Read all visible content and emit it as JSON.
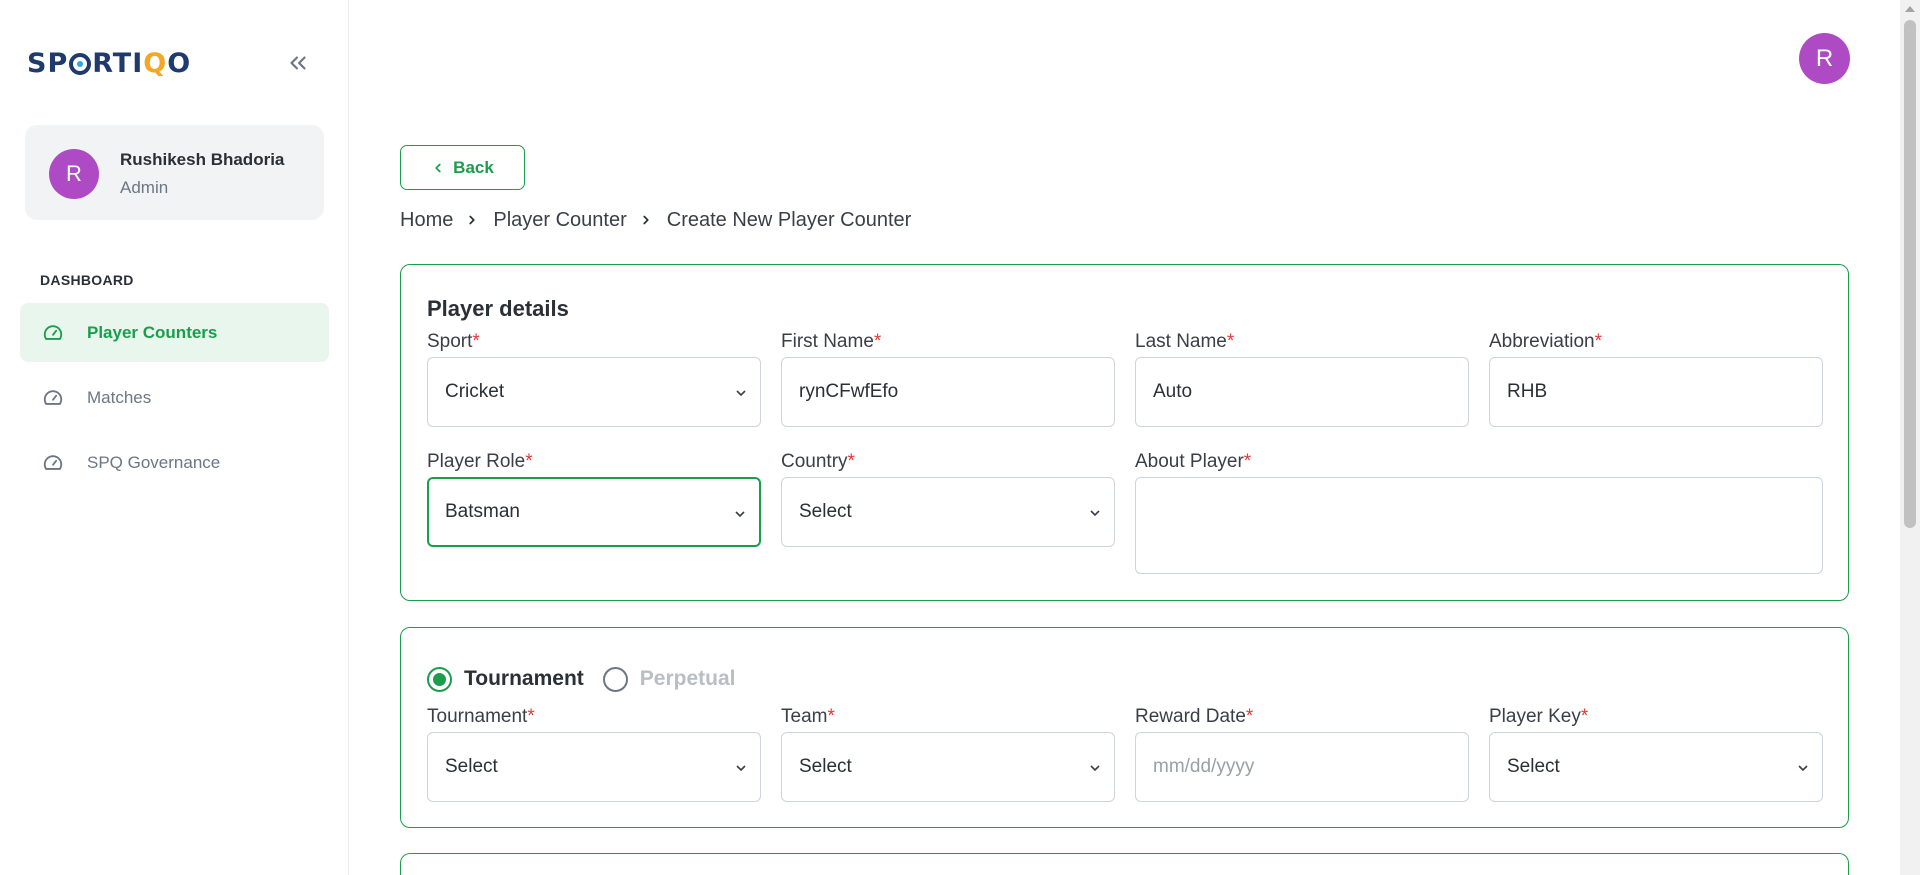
{
  "brand": {
    "logo_pre": "SP",
    "logo_mid": "RTI",
    "logo_accent": "Q",
    "logo_post": "O"
  },
  "user": {
    "initial": "R",
    "name": "Rushikesh Bhadoria",
    "role": "Admin"
  },
  "nav": {
    "heading": "DASHBOARD",
    "items": [
      {
        "label": "Player Counters",
        "icon": "gauge-icon",
        "active": true
      },
      {
        "label": "Matches",
        "icon": "gauge-icon",
        "active": false
      },
      {
        "label": "SPQ Governance",
        "icon": "gauge-icon",
        "active": false
      }
    ]
  },
  "header": {
    "avatar_initial": "R"
  },
  "back_label": "Back",
  "breadcrumb": [
    "Home",
    "Player Counter",
    "Create New Player Counter"
  ],
  "player_details": {
    "title": "Player details",
    "sport": {
      "label": "Sport",
      "value": "Cricket"
    },
    "first_name": {
      "label": "First Name",
      "value": "rynCFwfEfo"
    },
    "last_name": {
      "label": "Last Name",
      "value": "Auto"
    },
    "abbreviation": {
      "label": "Abbreviation",
      "value": "RHB"
    },
    "player_role": {
      "label": "Player Role",
      "value": "Batsman"
    },
    "country": {
      "label": "Country",
      "value": "Select"
    },
    "about_player": {
      "label": "About Player",
      "value": ""
    }
  },
  "counter_type": {
    "options": [
      {
        "label": "Tournament",
        "checked": true
      },
      {
        "label": "Perpetual",
        "checked": false
      }
    ],
    "tournament": {
      "label": "Tournament",
      "value": "Select"
    },
    "team": {
      "label": "Team",
      "value": "Select"
    },
    "reward_date": {
      "label": "Reward Date",
      "placeholder": "mm/dd/yyyy"
    },
    "player_key": {
      "label": "Player Key",
      "value": "Select"
    }
  },
  "required_mark": "*",
  "colors": {
    "accent": "#1a9e4b",
    "avatar": "#ae4bc4",
    "required": "#e53935",
    "brand_dark": "#1f3a6d",
    "brand_accent": "#f5a623"
  }
}
